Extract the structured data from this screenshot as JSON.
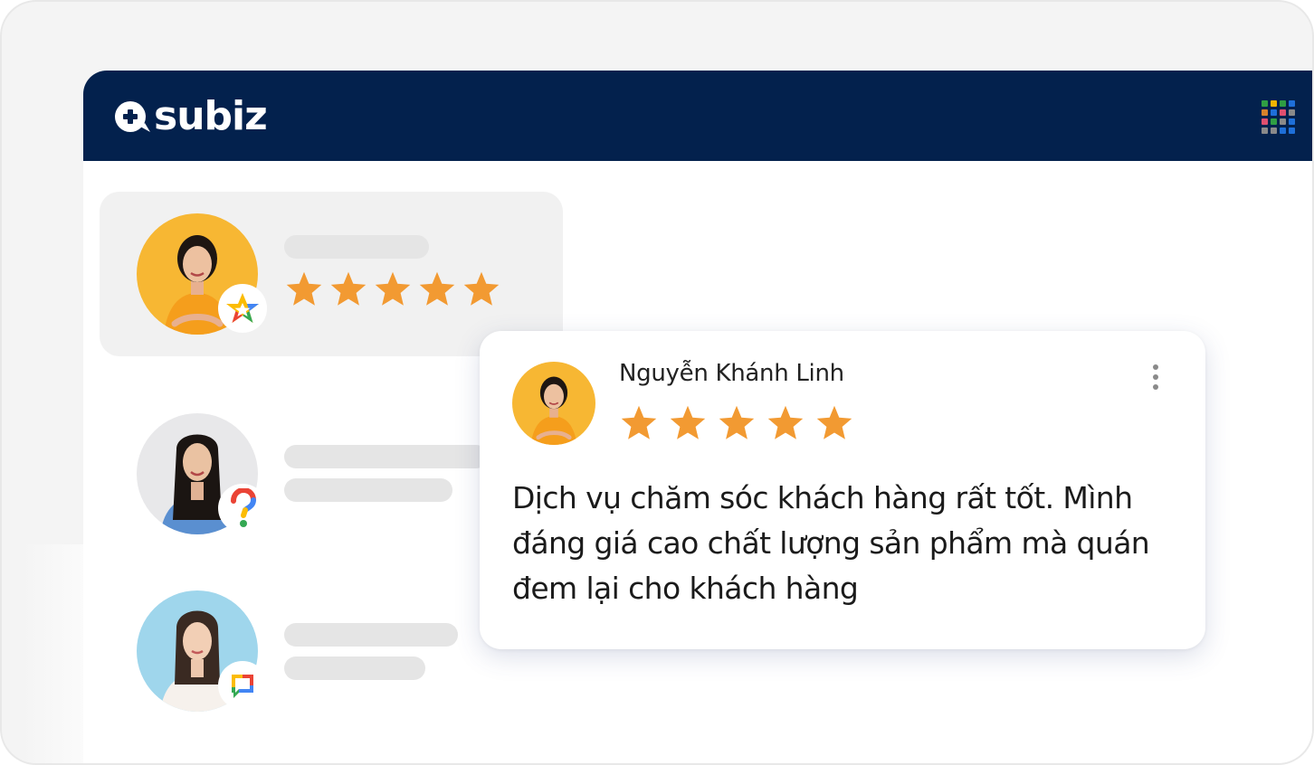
{
  "app": {
    "brand_name": "subiz",
    "apps_icon": "apps-grid-icon",
    "colors": {
      "header_bg": "#03214d",
      "star": "#f29a32",
      "card_active_bg": "#f1f1f1",
      "placeholder": "#e5e5e5"
    }
  },
  "review_list": {
    "items": [
      {
        "avatar": "customer-avatar-1",
        "channel_icon": "google-star-icon",
        "rating": 5,
        "max_rating": 5
      },
      {
        "avatar": "customer-avatar-2",
        "channel_icon": "google-question-icon"
      },
      {
        "avatar": "customer-avatar-3",
        "channel_icon": "google-chat-icon"
      }
    ]
  },
  "review_detail": {
    "reviewer_name": "Nguyễn Khánh Linh",
    "rating": 5,
    "max_rating": 5,
    "text": "Dịch vụ chăm sóc khách hàng rất tốt. Mình đáng giá cao chất lượng sản phẩm mà quán đem lại cho khách hàng",
    "menu_icon": "more-vertical-icon"
  }
}
